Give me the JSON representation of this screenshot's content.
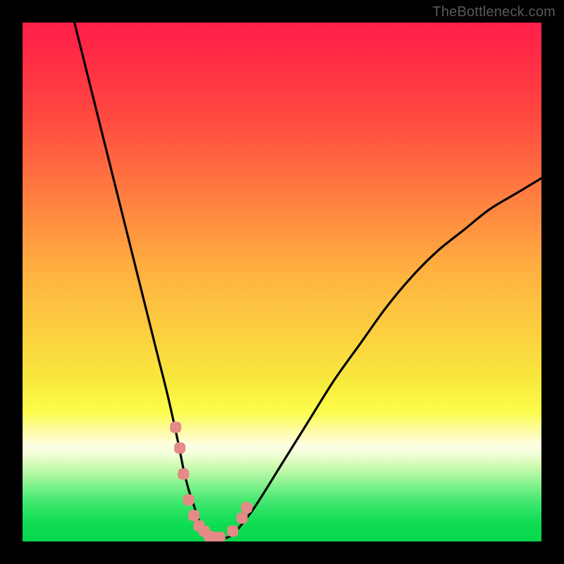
{
  "attribution": "TheBottleneck.com",
  "colors": {
    "background": "#000000",
    "curve_stroke": "#000000",
    "marker_fill": "#e58a87",
    "marker_stroke": "#d07070"
  },
  "chart_data": {
    "type": "line",
    "title": "",
    "xlabel": "",
    "ylabel": "",
    "xlim": [
      0,
      100
    ],
    "ylim": [
      0,
      100
    ],
    "series": [
      {
        "name": "bottleneck-curve",
        "x": [
          10,
          12,
          14,
          16,
          18,
          20,
          22,
          24,
          26,
          28,
          30,
          31,
          32,
          33,
          34,
          35,
          36,
          37,
          38,
          40,
          42,
          45,
          50,
          55,
          60,
          65,
          70,
          75,
          80,
          85,
          90,
          95,
          100
        ],
        "y": [
          100,
          92,
          84,
          76,
          68,
          60,
          52,
          44,
          36,
          28,
          19,
          14,
          10,
          7,
          4,
          2,
          1,
          0.5,
          0.5,
          1,
          3,
          7,
          15,
          23,
          31,
          38,
          45,
          51,
          56,
          60,
          64,
          67,
          70
        ]
      }
    ],
    "markers": {
      "name": "highlighted-points",
      "x": [
        29.5,
        30.3,
        31,
        32,
        33,
        34,
        35,
        36,
        37,
        38,
        40.5,
        42.3,
        43.2
      ],
      "y": [
        22,
        18,
        13,
        8,
        5,
        3,
        2,
        1,
        0.8,
        0.8,
        2,
        4.5,
        6.5
      ]
    }
  }
}
